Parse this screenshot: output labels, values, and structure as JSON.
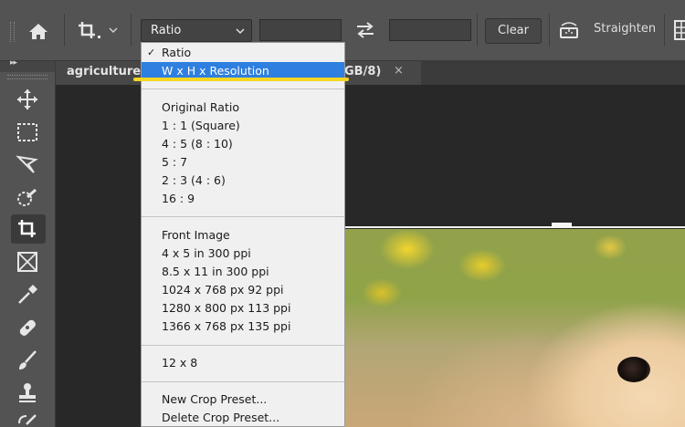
{
  "options_bar": {
    "ratio_select_value": "Ratio",
    "width_field_value": "",
    "height_field_value": "",
    "clear_label": "Clear",
    "straighten_label": "Straighten"
  },
  "document_tab": {
    "name": "agriculture-",
    "suffix": "GB/8)",
    "close": "×"
  },
  "dropdown": {
    "selected": {
      "check": "✓",
      "label": "Ratio"
    },
    "highlighted": "W x H x Resolution",
    "group_ratios": [
      "Original Ratio",
      "1 : 1 (Square)",
      "4 : 5 (8 : 10)",
      "5 : 7",
      "2 : 3 (4 : 6)",
      "16 : 9"
    ],
    "group_image": [
      "Front Image",
      "4 x 5 in 300 ppi",
      "8.5 x 11 in 300 ppi",
      "1024 x 768 px 92 ppi",
      "1280 x 800 px 113 ppi",
      "1366 x 768 px 135 ppi"
    ],
    "group_custom": [
      "12 x 8"
    ],
    "group_presets": [
      "New Crop Preset...",
      "Delete Crop Preset..."
    ]
  },
  "tools": [
    "move-tool",
    "marquee-tool",
    "lasso-tool",
    "quick-selection-tool",
    "crop-tool",
    "frame-tool",
    "eyedropper-tool",
    "healing-brush-tool",
    "brush-tool",
    "clone-stamp-tool",
    "history-brush-tool"
  ],
  "colors": {
    "highlight": "#2e7fe0",
    "annotation_underline": "#f5d623",
    "ui_panel": "#535353"
  }
}
